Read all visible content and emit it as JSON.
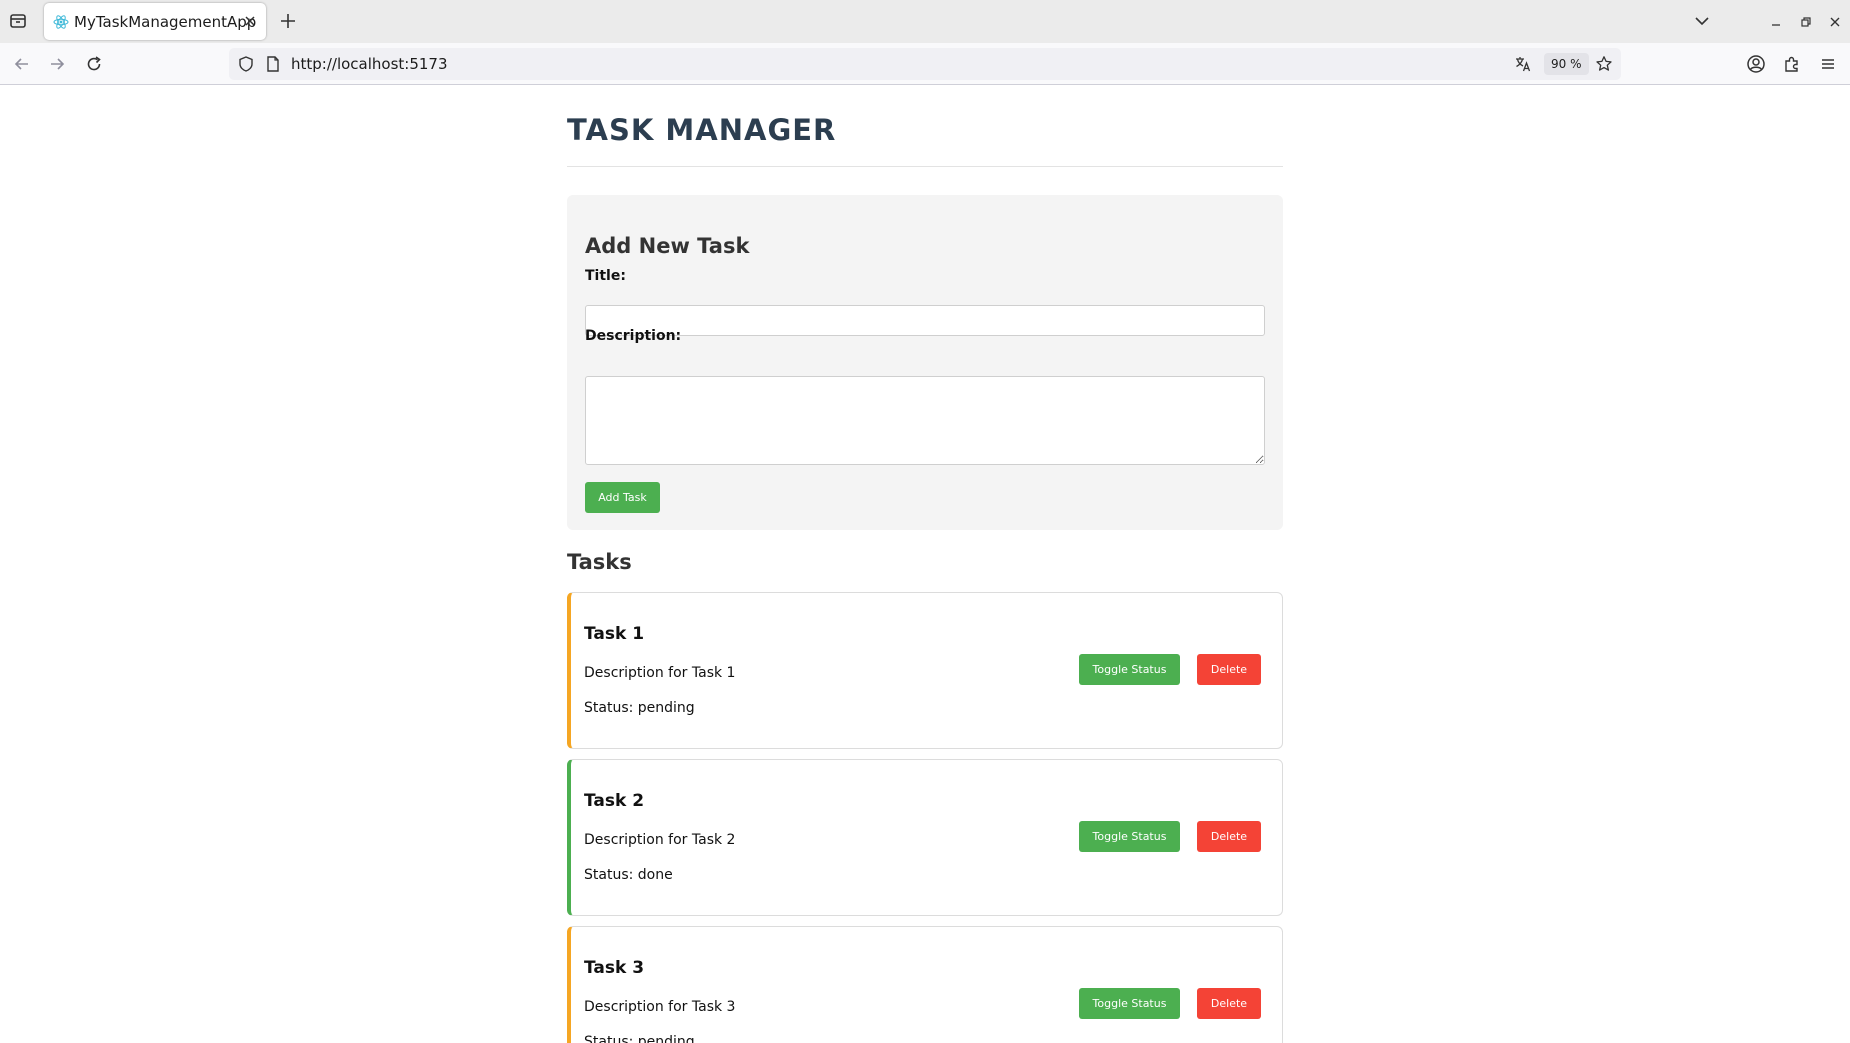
{
  "browser": {
    "tab": {
      "title": "MyTaskManagementApp",
      "favicon": "react-icon"
    },
    "url": "http://localhost:5173",
    "zoom": "90 %"
  },
  "app": {
    "title": "TASK MANAGER",
    "form": {
      "heading": "Add New Task",
      "title_label": "Title:",
      "title_value": "",
      "description_label": "Description:",
      "description_value": "",
      "add_button": "Add Task"
    },
    "tasks_heading": "Tasks",
    "tasks": [
      {
        "title": "Task 1",
        "description": "Description for Task 1",
        "status": "Status: pending",
        "state": "pending",
        "toggle_label": "Toggle Status",
        "delete_label": "Delete"
      },
      {
        "title": "Task 2",
        "description": "Description for Task 2",
        "status": "Status: done",
        "state": "done",
        "toggle_label": "Toggle Status",
        "delete_label": "Delete"
      },
      {
        "title": "Task 3",
        "description": "Description for Task 3",
        "status": "Status: pending",
        "state": "pending",
        "toggle_label": "Toggle Status",
        "delete_label": "Delete"
      }
    ]
  },
  "colors": {
    "pending_border": "#f5a623",
    "done_border": "#4caf50",
    "primary_button": "#4caf50",
    "danger_button": "#f44336",
    "title_color": "#2c3e50"
  }
}
